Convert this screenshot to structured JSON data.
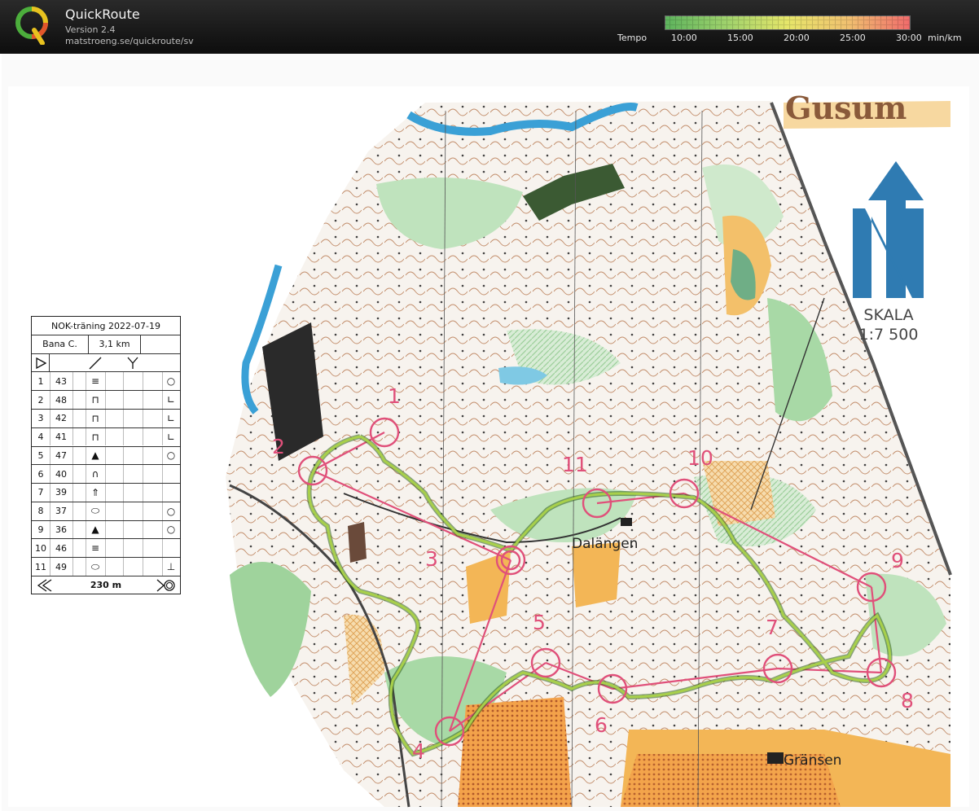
{
  "app": {
    "title": "QuickRoute",
    "version": "Version 2.4",
    "url": "matstroeng.se/quickroute/sv",
    "logo_letter": "Q"
  },
  "tempo": {
    "label": "Tempo",
    "ticks": [
      "10:00",
      "15:00",
      "20:00",
      "25:00",
      "30:00"
    ],
    "unit": "min/km",
    "colors": [
      "#5db35d",
      "#9fd26c",
      "#e6e66a",
      "#f0c070",
      "#f06b6b"
    ]
  },
  "map": {
    "title": "Gusum",
    "scale_label": "SKALA",
    "scale_value": "1:7 500",
    "place_names": [
      "Dalängen",
      "Gränsen"
    ],
    "control_color": "#e0507a",
    "route_color": "#8cbf3f",
    "controls": [
      "1",
      "2",
      "3",
      "4",
      "5",
      "6",
      "7",
      "8",
      "9",
      "10",
      "11"
    ]
  },
  "description": {
    "event": "NOK-träning 2022-07-19",
    "course": "Bana C.",
    "length": "3,1 km",
    "rows": [
      {
        "num": "1",
        "code": "43"
      },
      {
        "num": "2",
        "code": "48"
      },
      {
        "num": "3",
        "code": "42"
      },
      {
        "num": "4",
        "code": "41"
      },
      {
        "num": "5",
        "code": "47"
      },
      {
        "num": "6",
        "code": "40"
      },
      {
        "num": "7",
        "code": "39"
      },
      {
        "num": "8",
        "code": "37"
      },
      {
        "num": "9",
        "code": "36"
      },
      {
        "num": "10",
        "code": "46"
      },
      {
        "num": "11",
        "code": "49"
      }
    ],
    "finish_distance": "230 m"
  }
}
